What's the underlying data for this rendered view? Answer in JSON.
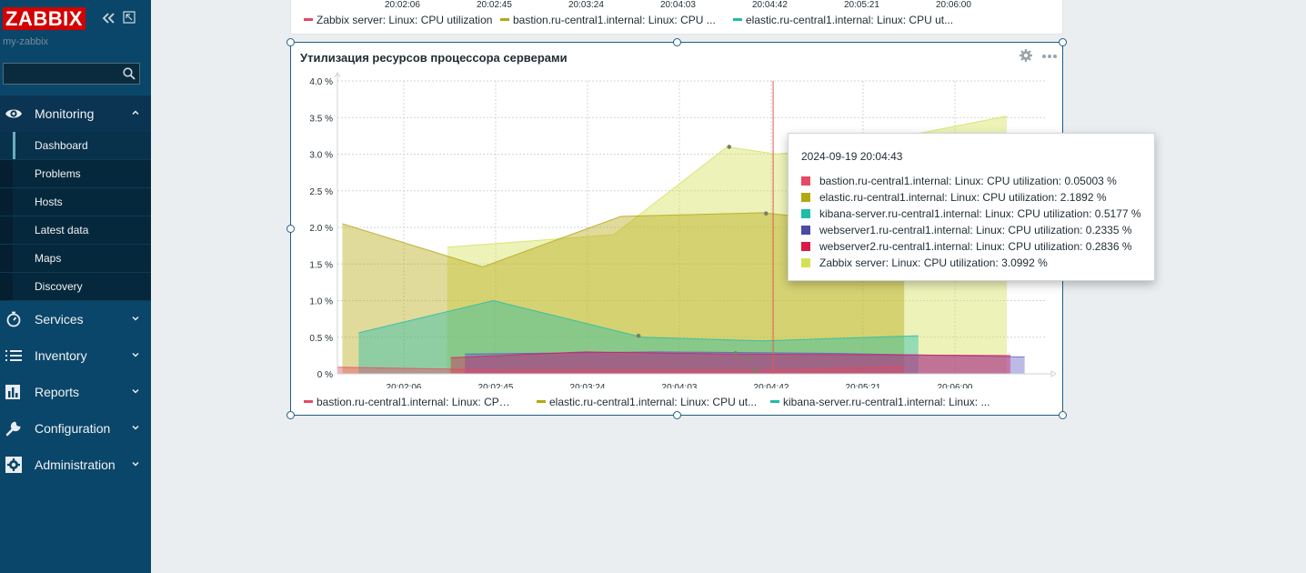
{
  "sidebar": {
    "logo": "ZABBIX",
    "server_name": "my-zabbix",
    "search": {
      "value": "",
      "placeholder": ""
    },
    "menu": [
      {
        "label": "Monitoring",
        "icon": "eye-icon",
        "expanded": true
      },
      {
        "label": "Services",
        "icon": "stopwatch-icon"
      },
      {
        "label": "Inventory",
        "icon": "list-icon"
      },
      {
        "label": "Reports",
        "icon": "bar-chart-icon"
      },
      {
        "label": "Configuration",
        "icon": "wrench-icon"
      },
      {
        "label": "Administration",
        "icon": "gear-icon"
      }
    ],
    "monitoring_items": [
      "Dashboard",
      "Problems",
      "Hosts",
      "Latest data",
      "Maps",
      "Discovery"
    ]
  },
  "top_widget": {
    "ticks": [
      "20:02:06",
      "20:02:45",
      "20:03:24",
      "20:04:03",
      "20:04:42",
      "20:05:21",
      "20:06:00"
    ],
    "legend": [
      {
        "label": "Zabbix server: Linux: CPU utilization",
        "color": "#e54a66"
      },
      {
        "label": "bastion.ru-central1.internal: Linux: CPU ...",
        "color": "#b4a811"
      },
      {
        "label": "elastic.ru-central1.internal: Linux: CPU ut...",
        "color": "#1fbcac"
      }
    ]
  },
  "widget": {
    "title": "Утилизация ресурсов процессора серверами",
    "legend": [
      {
        "label": "bastion.ru-central1.internal: Linux: CPU ...",
        "color": "#e54a66"
      },
      {
        "label": "elastic.ru-central1.internal: Linux: CPU ut...",
        "color": "#b4a811"
      },
      {
        "label": "kibana-server.ru-central1.internal: Linux: ...",
        "color": "#1fbcac"
      }
    ]
  },
  "chart_data": {
    "type": "area",
    "x": [
      "20:02:06",
      "20:02:45",
      "20:03:24",
      "20:04:03",
      "20:04:42",
      "20:05:21",
      "20:06:00"
    ],
    "yticks": [
      "0 %",
      "0.5 %",
      "1.0 %",
      "1.5 %",
      "2.0 %",
      "2.5 %",
      "3.0 %",
      "3.5 %",
      "4.0 %"
    ],
    "ylim": [
      0,
      4
    ],
    "series": [
      {
        "name": "Zabbix server",
        "color": "#d4e157",
        "points": [
          [
            0.155,
            1.73
          ],
          [
            0.39,
            1.9
          ],
          [
            0.55,
            3.1
          ],
          [
            0.62,
            3.0
          ],
          [
            0.75,
            3.15
          ],
          [
            0.945,
            3.52
          ]
        ]
      },
      {
        "name": "elastic",
        "color": "#b4a811",
        "points": [
          [
            0.007,
            2.05
          ],
          [
            0.205,
            1.46
          ],
          [
            0.4,
            2.15
          ],
          [
            0.6,
            2.2
          ],
          [
            0.8,
            2.0
          ]
        ]
      },
      {
        "name": "kibana-server",
        "color": "#1fbcac",
        "points": [
          [
            0.03,
            0.56
          ],
          [
            0.22,
            1.0
          ],
          [
            0.43,
            0.5
          ],
          [
            0.6,
            0.45
          ],
          [
            0.82,
            0.52
          ]
        ]
      },
      {
        "name": "webserver1",
        "color": "#5c5cc4",
        "points": [
          [
            0.18,
            0.27
          ],
          [
            0.45,
            0.3
          ],
          [
            0.7,
            0.28
          ],
          [
            0.97,
            0.23
          ]
        ]
      },
      {
        "name": "webserver2",
        "color": "#d81b60",
        "points": [
          [
            0.16,
            0.22
          ],
          [
            0.35,
            0.3
          ],
          [
            0.55,
            0.27
          ],
          [
            0.95,
            0.25
          ]
        ]
      },
      {
        "name": "bastion",
        "color": "#e54a66",
        "points": [
          [
            0.0,
            0.09
          ],
          [
            0.25,
            0.05
          ],
          [
            0.6,
            0.05
          ],
          [
            0.8,
            0.1
          ]
        ]
      }
    ],
    "cursor_x": 0.615
  },
  "tooltip": {
    "title": "2024-09-19 20:04:43",
    "rows": [
      {
        "label": "bastion.ru-central1.internal: Linux: CPU utilization: 0.05003 %",
        "color": "#e54a66"
      },
      {
        "label": "elastic.ru-central1.internal: Linux: CPU utilization: 2.1892 %",
        "color": "#b4a811"
      },
      {
        "label": "kibana-server.ru-central1.internal: Linux: CPU utilization: 0.5177 %",
        "color": "#1fbcac"
      },
      {
        "label": "webserver1.ru-central1.internal: Linux: CPU utilization: 0.2335 %",
        "color": "#4a4aa8"
      },
      {
        "label": "webserver2.ru-central1.internal: Linux: CPU utilization: 0.2836 %",
        "color": "#d81b44"
      },
      {
        "label": "Zabbix server: Linux: CPU utilization: 3.0992 %",
        "color": "#d4e157"
      }
    ]
  }
}
